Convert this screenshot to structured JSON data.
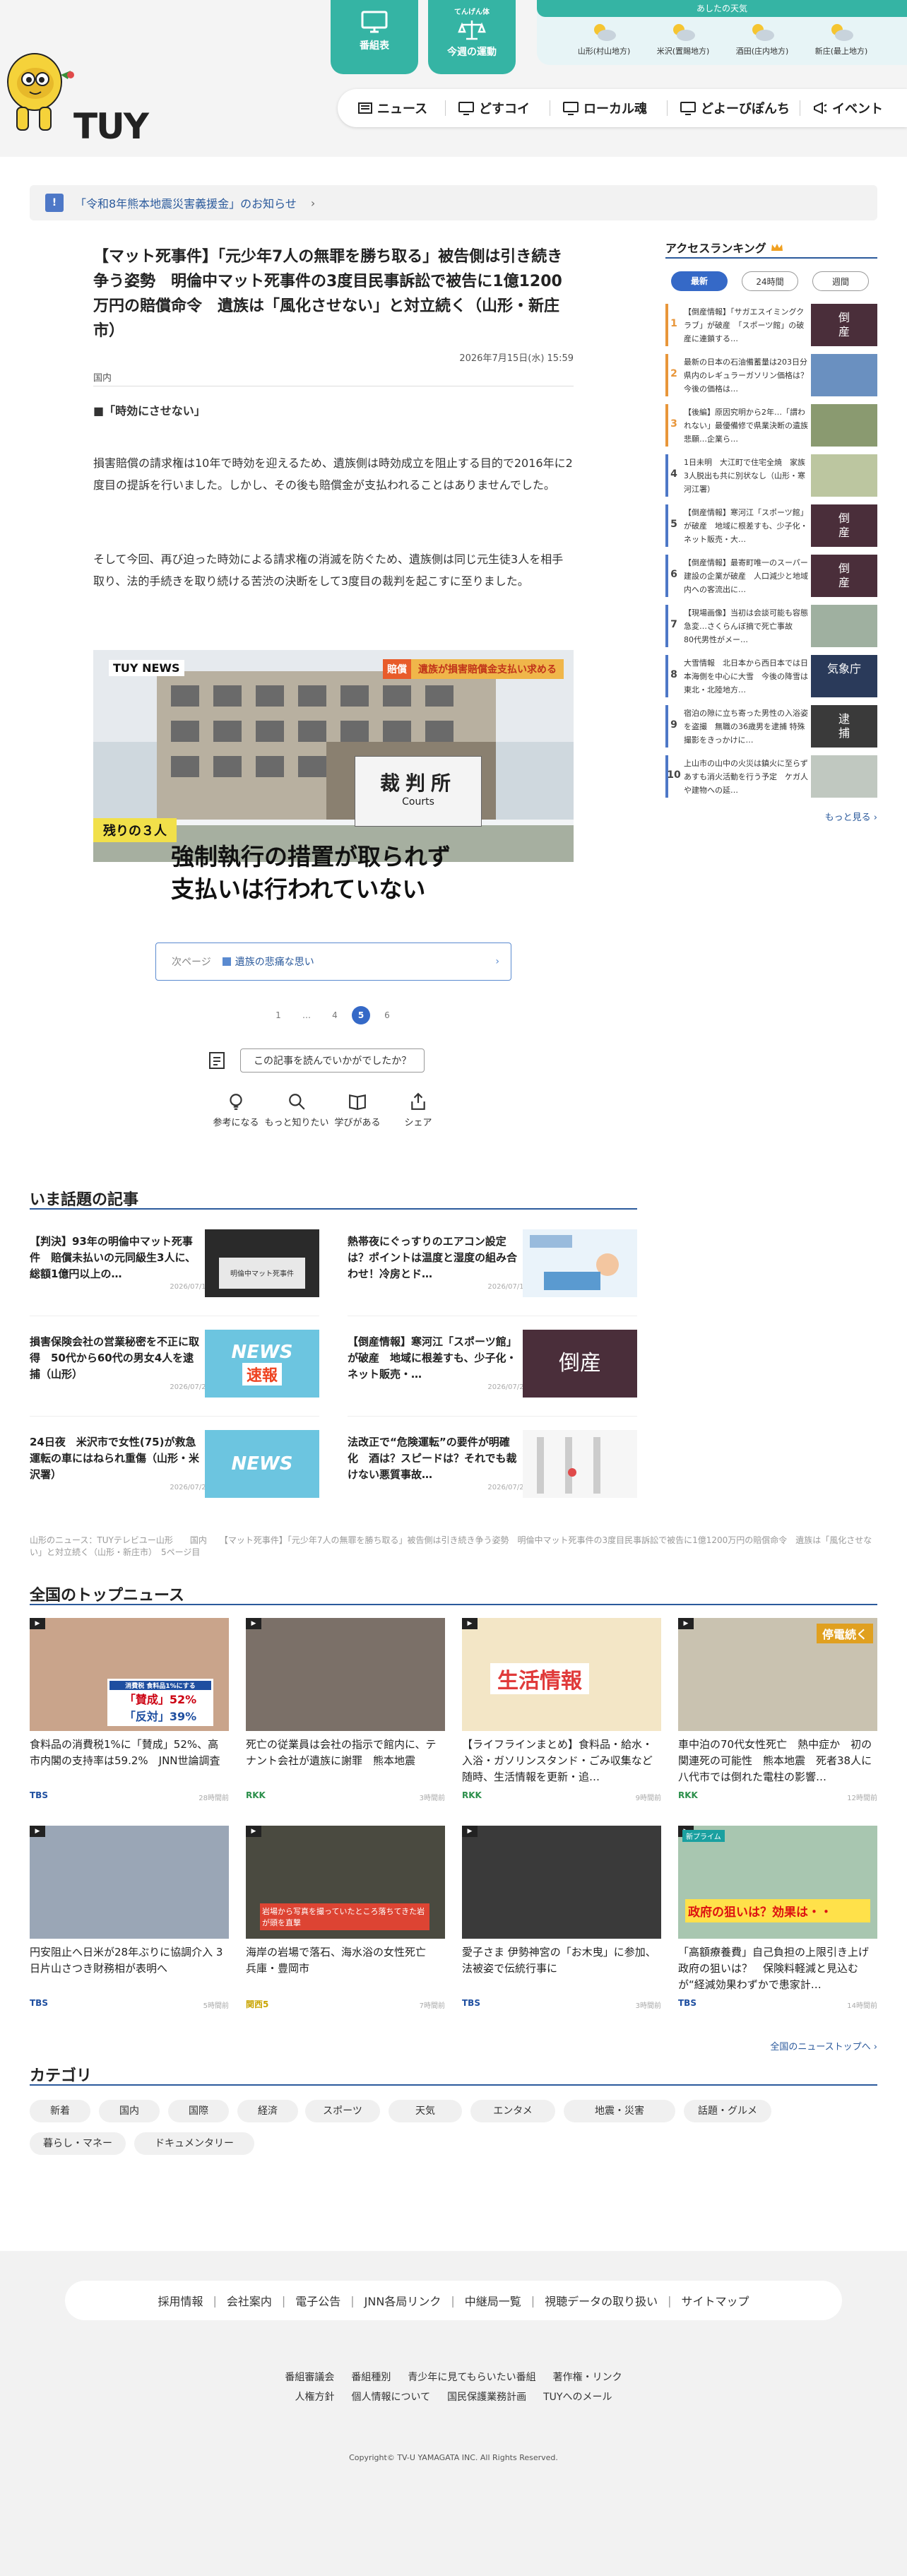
{
  "header": {
    "logo_text": "TUY",
    "btn_program": "番組表",
    "btn_exercise_small": "てんげん体",
    "btn_exercise": "今週の運動",
    "weather_title": "あしたの天気",
    "weather": [
      {
        "area": "山形(村山地方)",
        "icon": "sun-cloud-icon"
      },
      {
        "area": "米沢(置賜地方)",
        "icon": "sun-cloud-icon"
      },
      {
        "area": "酒田(庄内地方)",
        "icon": "sun-cloud-icon"
      },
      {
        "area": "新庄(最上地方)",
        "icon": "sun-cloud-icon"
      }
    ],
    "nav": [
      "ニュース",
      "どすコイ",
      "ローカル魂",
      "どよーびぽんち",
      "イベント"
    ]
  },
  "notice": {
    "badge": "!",
    "text": "「令和8年熊本地震災害義援金」のお知らせ",
    "arrow": "›"
  },
  "article": {
    "title": "【マット死事件】「元少年7人の無罪を勝ち取る」被告側は引き続き争う姿勢　明倫中マット死事件の3度目民事訴訟で被告に1億1200万円の賠償命令　遺族は「風化させない」と対立続く（山形・新庄市）",
    "date": "2026年7月15日(水) 15:59",
    "category": "国内",
    "subhead": "■「時効にさせない」",
    "p1": "損害賠償の請求権は10年で時効を迎えるため、遺族側は時効成立を阻止する目的で2016年に2度目の提訴を行いました。しかし、その後も賠償金が支払われることはありませんでした。",
    "p2": "そして今回、再び迫った時効による請求権の消滅を防ぐため、遺族側は同じ元生徒3人を相手取り、法的手続きを取り続ける苦渋の決断をして3度目の裁判を起こすに至りました。",
    "photo": {
      "watermark": "TUY NEWS",
      "banner_tag": "賠償",
      "banner": "遺族が損害賠償金支払い求める",
      "sign": "裁判所",
      "sign_en": "Courts",
      "tag": "残りの３人",
      "caption1": "強制執行の措置が取られず",
      "caption2": "支払いは行われていない"
    },
    "next_label": "次ページ",
    "next_title": "遺族の悲痛な思い",
    "next_arrow": "›",
    "pages": [
      "1",
      "…",
      "4",
      "5",
      "6"
    ],
    "current_page": "5",
    "feedback_q": "この記事を読んでいかがでしたか？",
    "reactions": [
      "参考になる",
      "もっと知りたい",
      "学びがある",
      "シェア"
    ]
  },
  "trending": {
    "heading": "いま話題の記事",
    "items": [
      {
        "title": "【判決】93年の明倫中マット死事件　賠償未払いの元同級生3人に、総額1億円以上の…",
        "date": "2026/07/15"
      },
      {
        "title": "熱帯夜にぐっすりのエアコン設定は？ポイントは温度と湿度の組み合わせ！冷房とド…",
        "date": "2026/07/14"
      },
      {
        "title": "損害保険会社の営業秘密を不正に取得　50代から60代の男女4人を逮捕（山形）",
        "date": "2026/07/21"
      },
      {
        "title": "【倒産情報】寒河江「スポーツ館」が破産　地域に根差すも、少子化・ネット販売・…",
        "date": "2026/07/23"
      },
      {
        "title": "24日夜　米沢市で女性(75)が救急運転の車にはねられ重傷（山形・米沢署）",
        "date": "2026/07/25"
      },
      {
        "title": "法改正で“危険運転”の要件が明確化　酒は？スピードは？それでも裁けない悪質事故…",
        "date": "2026/07/26"
      }
    ],
    "img_texts": {
      "news": "NEWS",
      "sokuhou": "速報",
      "tousan": "倒産"
    }
  },
  "breadcrumb": "山形のニュース：TUYテレビユー山形　　国内　　【マット死事件】「元少年7人の無罪を勝ち取る」被告側は引き続き争う姿勢　明倫中マット死事件の3度目民事訴訟で被告に1億1200万円の賠償命令　遺族は「風化させない」と対立続く（山形・新庄市）　5ページ目",
  "national": {
    "heading": "全国のトップニュース",
    "items": [
      {
        "title": "食料品の消費税1%に「賛成」52%、高市内閣の支持率は59.2%　JNN世論調査",
        "source": "TBS",
        "src_color": "#1f4fa0",
        "date": "28時間前"
      },
      {
        "title": "死亡の従業員は会社の指示で館内に、テナント会社が遺族に謝罪　熊本地震",
        "source": "RKK",
        "src_color": "#2a8f4a",
        "date": "3時間前"
      },
      {
        "title": "【ライフラインまとめ】食料品・給水・入浴・ガソリンスタンド・ごみ収集など　随時、生活情報を更新・追…",
        "source": "RKK",
        "src_color": "#2a8f4a",
        "date": "9時間前"
      },
      {
        "title": "車中泊の70代女性死亡　熱中症か　初の関連死の可能性　熊本地震　死者38人に　八代市では倒れた電柱の影響…",
        "source": "RKK",
        "src_color": "#2a8f4a",
        "date": "12時間前"
      },
      {
        "title": "円安阻止へ日米が28年ぶりに協調介入 3日片山さつき財務相が表明へ",
        "source": "TBS",
        "src_color": "#1f4fa0",
        "date": "5時間前"
      },
      {
        "title": "海岸の岩場で落石、海水浴の女性死亡　兵庫・豊岡市",
        "source": "関西5",
        "src_color": "#c9a400",
        "date": "7時間前"
      },
      {
        "title": "愛子さま 伊勢神宮の「お木曳」に参加、法被姿で伝統行事に",
        "source": "TBS",
        "src_color": "#1f4fa0",
        "date": "3時間前"
      },
      {
        "title": "「高額療養費」自己負担の上限引き上げ　政府の狙いは？　保険料軽減と見込むが“経減効果わずかで患家計…",
        "source": "TBS",
        "src_color": "#1f4fa0",
        "date": "14時間前"
      }
    ],
    "img_texts": {
      "poll_yes": "「賛成」52%",
      "poll_no": "「反対」39%",
      "poll_head": "消費税 食料品1%にする",
      "seikatsu": "生活情報",
      "teiden": "停電続く",
      "rock": "岩場から写真を撮っていたところ落ちてきた岩が頭を直撃",
      "aim": "政府の狙いは？効果は・・",
      "aim_tag": "新プライム"
    },
    "more": "全国のニューストップへ ›"
  },
  "categories": {
    "heading": "カテゴリ",
    "items": [
      "新着",
      "国内",
      "国際",
      "経済",
      "スポーツ",
      "天気",
      "エンタメ",
      "地震・災害",
      "話題・グルメ",
      "暮らし・マネー",
      "ドキュメンタリー"
    ]
  },
  "ranking": {
    "heading": "アクセスランキング",
    "tabs": [
      "最新",
      "24時間",
      "週間"
    ],
    "items": [
      {
        "rank": "1",
        "title": "【倒産情報】「サガエスイミングクラブ」が破産　「スポーツ館」の破産に連鎖する…",
        "color": "#e8963a",
        "img": "倒\n産"
      },
      {
        "rank": "2",
        "title": "最新の日本の石油備蓄量は203日分　県内のレギュラーガソリン価格は？ 今後の価格は…",
        "color": "#e8963a",
        "img": ""
      },
      {
        "rank": "3",
        "title": "【後編】原因究明から2年…「謂われない」最優備修で県業決断の遺族悲願…企業ら…",
        "color": "#e8963a",
        "img": ""
      },
      {
        "rank": "4",
        "title": "1日未明　大江町で住宅全焼　家族3人脱出も共に別状なし（山形・寒河江署）",
        "color": "#4e78c7",
        "img": ""
      },
      {
        "rank": "5",
        "title": "【倒産情報】寒河江「スポーツ館」が破産　地域に根差すも、少子化・ネット販売・大…",
        "color": "#4e78c7",
        "img": "倒\n産"
      },
      {
        "rank": "6",
        "title": "【倒産情報】最寄町唯一のスーパー建設の企業が破産　人口減少と地域内への客流出に…",
        "color": "#4e78c7",
        "img": "倒\n産"
      },
      {
        "rank": "7",
        "title": "【現場画像】当初は会談可能も容態急変…さくらんぼ摘で死亡事故　80代男性がメー…",
        "color": "#4e78c7",
        "img": ""
      },
      {
        "rank": "8",
        "title": "大雪情報　北日本から西日本では日本海側を中心に大雪　今後の降雪は東北・北陸地方…",
        "color": "#4e78c7",
        "img": "気象庁"
      },
      {
        "rank": "9",
        "title": "宿泊の隙に立ち寄った男性の入浴姿を盗撮　無職の36歳男を逮捕 特殊撮影をきっかけに…",
        "color": "#4e78c7",
        "img": "逮\n捕"
      },
      {
        "rank": "10",
        "title": "上山市の山中の火災は鎮火に至らず　あすも消火活動を行う予定　ケガ人や建物への延…",
        "color": "#4e78c7",
        "img": ""
      }
    ],
    "more": "もっと見る ›"
  },
  "footer": {
    "nav": [
      "採用情報",
      "会社案内",
      "電子公告",
      "JNN各局リンク",
      "中継局一覧",
      "視聴データの取り扱い",
      "サイトマップ"
    ],
    "links1": [
      "番組審議会",
      "番組種別",
      "青少年に見てもらいたい番組",
      "著作権・リンク"
    ],
    "links2": [
      "人権方針",
      "個人情報について",
      "国民保護業務計画",
      "TUYへのメール"
    ],
    "copyright": "Copyright© TV-U YAMAGATA INC. All Rights Reserved."
  },
  "colors": {
    "teal": "#35b4a4",
    "blue": "#2b5a9c",
    "accent": "#3569c7"
  }
}
